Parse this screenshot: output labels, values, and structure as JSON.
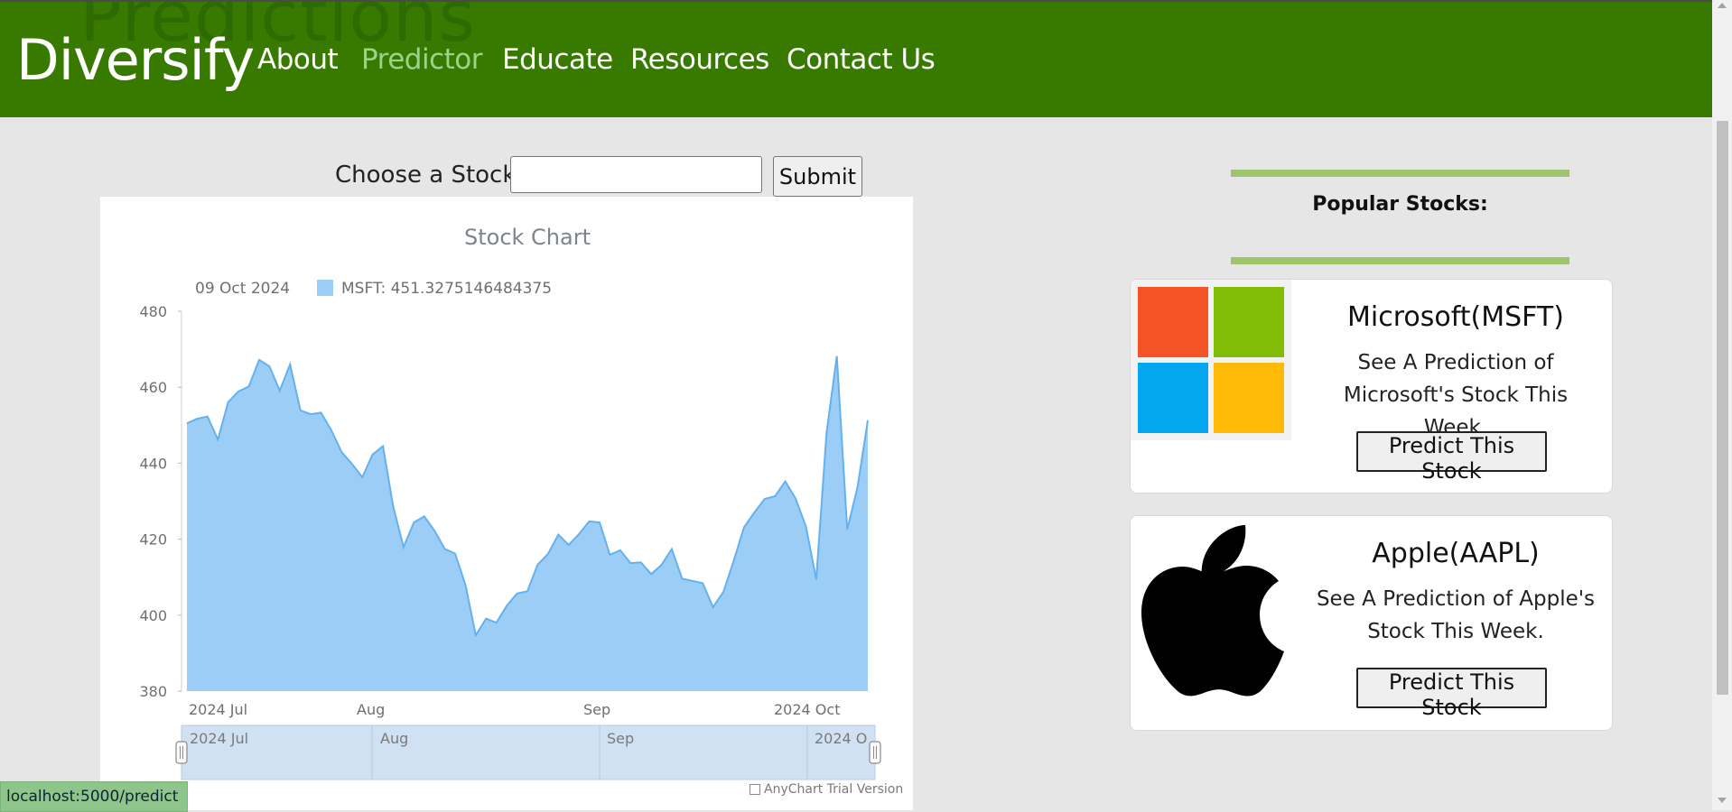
{
  "header": {
    "ghost_title": "Predictions",
    "brand": "Diversify",
    "nav": [
      {
        "label": "About"
      },
      {
        "label": "Predictor"
      },
      {
        "label": "Educate"
      },
      {
        "label": "Resources"
      },
      {
        "label": "Contact Us"
      }
    ],
    "colors": {
      "background": "#387a00",
      "active_link": "#9bd38a"
    }
  },
  "form": {
    "label": "Choose a Stock:",
    "input_value": "",
    "submit_label": "Submit"
  },
  "chart_data": {
    "type": "area",
    "title": "Stock Chart",
    "tooltip": {
      "date": "09 Oct 2024",
      "text": "MSFT: 451.3275146484375"
    },
    "series": [
      {
        "name": "MSFT",
        "color": "#9ccdf6"
      }
    ],
    "ylim": [
      380,
      480
    ],
    "y_ticks": [
      "480",
      "460",
      "440",
      "420",
      "400",
      "380"
    ],
    "x_ticks": [
      "2024 Jul",
      "Aug",
      "Sep",
      "2024 Oct"
    ],
    "values": [
      450.5,
      451.7,
      452.3,
      446.2,
      456.1,
      458.9,
      460.2,
      467.2,
      465.5,
      459.1,
      466.0,
      453.9,
      452.9,
      453.3,
      448.7,
      442.9,
      439.8,
      436.3,
      442.3,
      444.5,
      428.5,
      417.9,
      424.4,
      426.0,
      422.2,
      417.4,
      416.2,
      407.9,
      394.7,
      399.1,
      398.0,
      402.5,
      405.7,
      406.3,
      413.3,
      416.1,
      421.2,
      418.5,
      421.3,
      424.7,
      424.4,
      415.9,
      417.1,
      413.7,
      413.9,
      410.8,
      413.2,
      417.4,
      409.6,
      409.0,
      408.4,
      402.1,
      406.1,
      414.3,
      423.1,
      427.0,
      430.6,
      431.3,
      435.2,
      430.7,
      423.3,
      409.4,
      448.0,
      468.2,
      422.5,
      433.7,
      451.3
    ],
    "navigator_labels": [
      "2024 Jul",
      "Aug",
      "Sep",
      "2024 O"
    ],
    "watermark": "AnyChart Trial Version"
  },
  "sidebar": {
    "title": "Popular Stocks:",
    "cards": [
      {
        "title": "Microsoft(MSFT)",
        "desc": "See A Prediction of Microsoft's Stock This Week.",
        "button": "Predict This Stock",
        "logo_colors": [
          "#f35325",
          "#81bc06",
          "#05a6f0",
          "#ffba08"
        ]
      },
      {
        "title": "Apple(AAPL)",
        "desc": "See A Prediction of Apple's Stock This Week.",
        "button": "Predict This Stock"
      }
    ]
  },
  "status_bar": {
    "url": "localhost:5000/predict"
  }
}
